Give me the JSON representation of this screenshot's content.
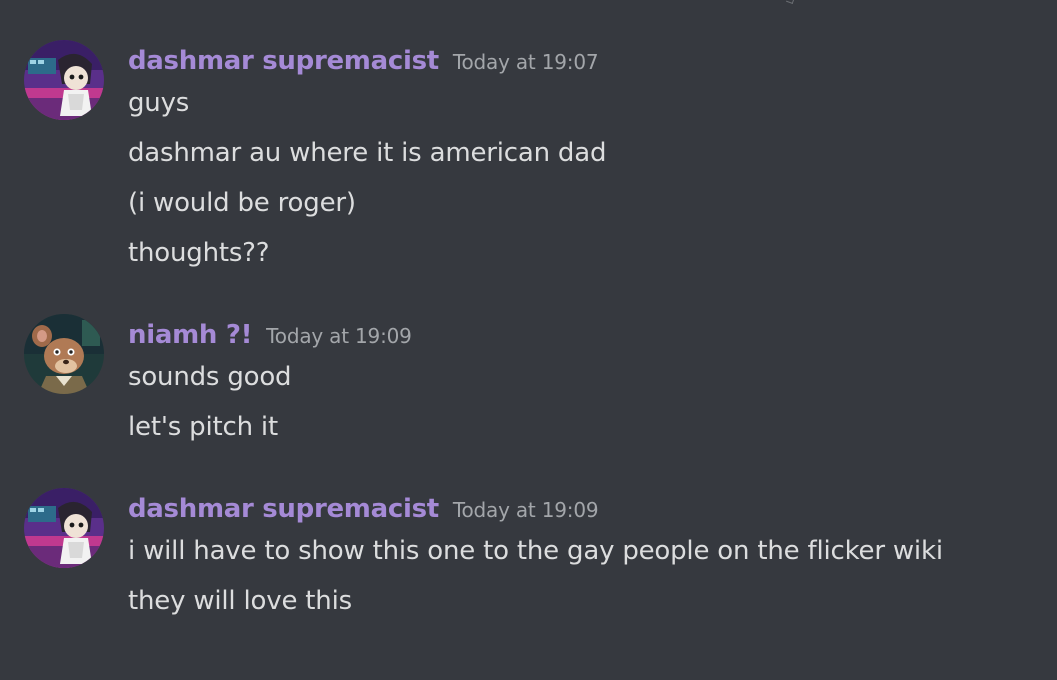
{
  "messages": [
    {
      "username": "dashmar supremacist",
      "timestamp": "Today at 19:07",
      "avatar_icon": "purple-room-character-avatar",
      "lines": [
        "guys",
        "dashmar au where it is american dad",
        "(i would be roger)",
        "thoughts??"
      ]
    },
    {
      "username": "niamh ?!",
      "timestamp": "Today at 19:09",
      "avatar_icon": "cartoon-rat-avatar",
      "lines": [
        "sounds good",
        "let's pitch it"
      ]
    },
    {
      "username": "dashmar supremacist",
      "timestamp": "Today at 19:09",
      "avatar_icon": "purple-room-character-avatar",
      "lines": [
        "i will have to show this one to the gay people on the flicker wiki",
        "they will love this"
      ]
    }
  ],
  "colors": {
    "background": "#36393f",
    "username": "#a58ad6",
    "timestamp": "#a3a6aa",
    "message_text": "#dcddde"
  }
}
